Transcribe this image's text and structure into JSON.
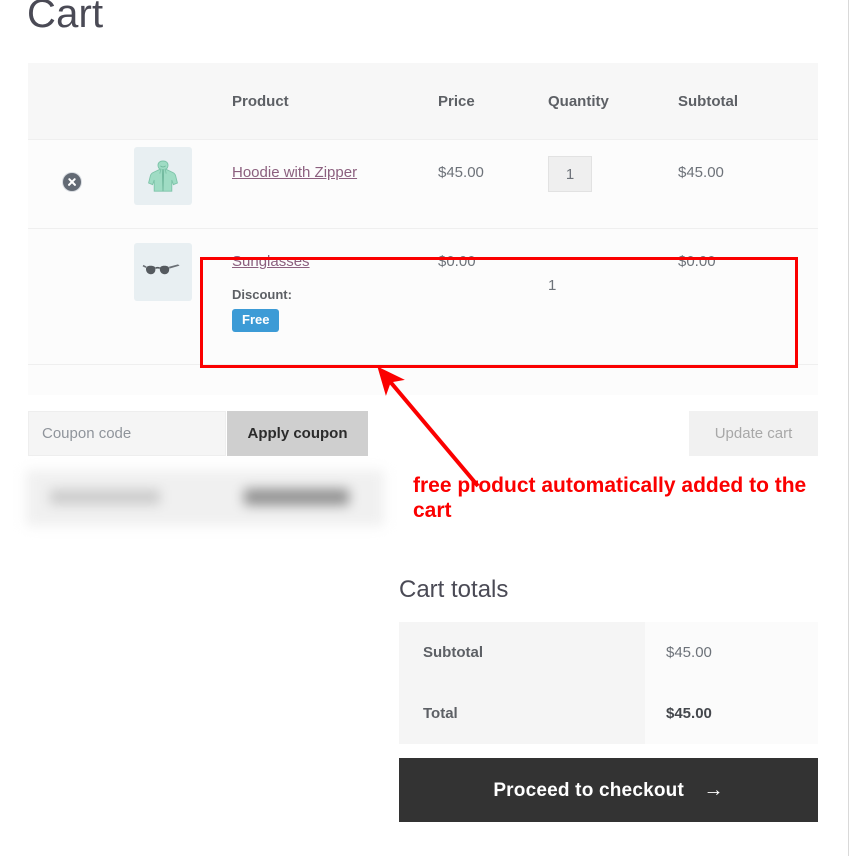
{
  "page": {
    "title": "Cart"
  },
  "cart_table": {
    "headers": [
      "",
      "",
      "Product",
      "Price",
      "Quantity",
      "Subtotal"
    ],
    "rows": [
      {
        "remove_icon": "remove-circle-x-icon",
        "thumb_icon": "hoodie-thumbnail",
        "product": "Hoodie with Zipper",
        "price": "$45.00",
        "quantity": "1",
        "subtotal": "$45.00",
        "discount_label": "",
        "discount_badge": ""
      },
      {
        "remove_icon": "",
        "thumb_icon": "sunglasses-thumbnail",
        "product": "Sunglasses",
        "price": "$0.00",
        "quantity": "1",
        "subtotal": "$0.00",
        "discount_label": "Discount:",
        "discount_badge": "Free"
      }
    ]
  },
  "coupon": {
    "placeholder": "Coupon code",
    "value": "",
    "apply_label": "Apply coupon",
    "update_cart_label": "Update cart"
  },
  "annotation": {
    "text": "free product automatically added to the cart",
    "color": "#fb0000",
    "arrow_icon": "arrow-up-left-icon",
    "highlight_box": "red-highlight-rectangle"
  },
  "totals": {
    "title": "Cart totals",
    "rows": [
      {
        "label": "Subtotal",
        "value": "$45.00"
      },
      {
        "label": "Total",
        "value": "$45.00"
      }
    ],
    "checkout_label": "Proceed to checkout",
    "checkout_arrow": "→"
  },
  "colors": {
    "accent_badge": "#3c9bd6",
    "annotation_red": "#fb0000",
    "link": "#8b5f7e",
    "checkout_bg": "#333333"
  }
}
